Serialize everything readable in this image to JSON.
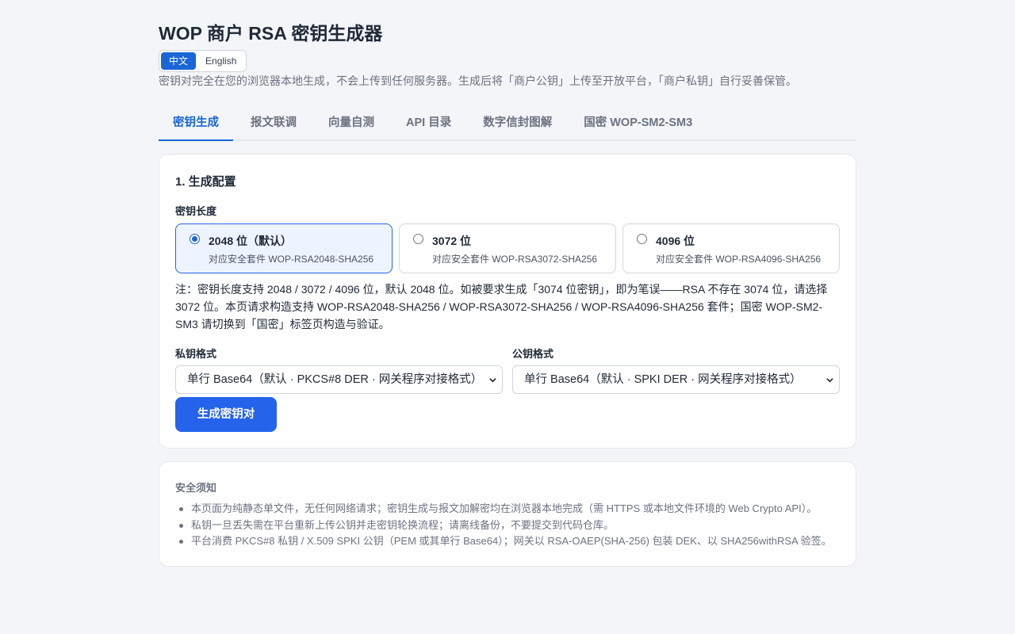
{
  "header": {
    "title": "WOP 商户 RSA 密钥生成器",
    "languages": [
      "中文",
      "English"
    ],
    "active_language": "中文",
    "subtitle": "密钥对完全在您的浏览器本地生成，不会上传到任何服务器。生成后将「商户公钥」上传至开放平台，「商户私钥」自行妥善保管。"
  },
  "tabs": [
    {
      "label": "密钥生成",
      "active": true
    },
    {
      "label": "报文联调",
      "active": false
    },
    {
      "label": "向量自测",
      "active": false
    },
    {
      "label": "API 目录",
      "active": false
    },
    {
      "label": "数字信封图解",
      "active": false
    },
    {
      "label": "国密 WOP-SM2-SM3",
      "active": false
    }
  ],
  "config": {
    "section_title": "1. 生成配置",
    "key_length_label": "密钥长度",
    "options": [
      {
        "title": "2048 位（默认）",
        "desc": "对应安全套件 WOP-RSA2048-SHA256",
        "selected": true
      },
      {
        "title": "3072 位",
        "desc": "对应安全套件 WOP-RSA3072-SHA256",
        "selected": false
      },
      {
        "title": "4096 位",
        "desc": "对应安全套件 WOP-RSA4096-SHA256",
        "selected": false
      }
    ],
    "note": "注：密钥长度支持 2048 / 3072 / 4096 位，默认 2048 位。如被要求生成「3074 位密钥」，即为笔误——RSA 不存在 3074 位，请选择 3072 位。本页请求构造支持 WOP-RSA2048-SHA256 / WOP-RSA3072-SHA256 / WOP-RSA4096-SHA256 套件；国密 WOP-SM2-SM3 请切换到「国密」标签页构造与验证。",
    "private_format_label": "私钥格式",
    "private_format_value": "单行 Base64（默认 · PKCS#8 DER · 网关程序对接格式）",
    "public_format_label": "公钥格式",
    "public_format_value": "单行 Base64（默认 · SPKI DER · 网关程序对接格式）",
    "generate_button": "生成密钥对"
  },
  "security": {
    "title": "安全须知",
    "items": [
      "本页面为纯静态单文件，无任何网络请求；密钥生成与报文加解密均在浏览器本地完成（需 HTTPS 或本地文件环境的 Web Crypto API）。",
      "私钥一旦丢失需在平台重新上传公钥并走密钥轮换流程；请离线备份，不要提交到代码仓库。",
      "平台消费 PKCS#8 私钥 / X.509 SPKI 公钥（PEM 或其单行 Base64）；网关以 RSA-OAEP(SHA-256) 包装 DEK、以 SHA256withRSA 验签。"
    ]
  },
  "colors": {
    "accent": "#2563eb",
    "tab_active": "#1a66d6",
    "background": "#f3f5f8"
  }
}
